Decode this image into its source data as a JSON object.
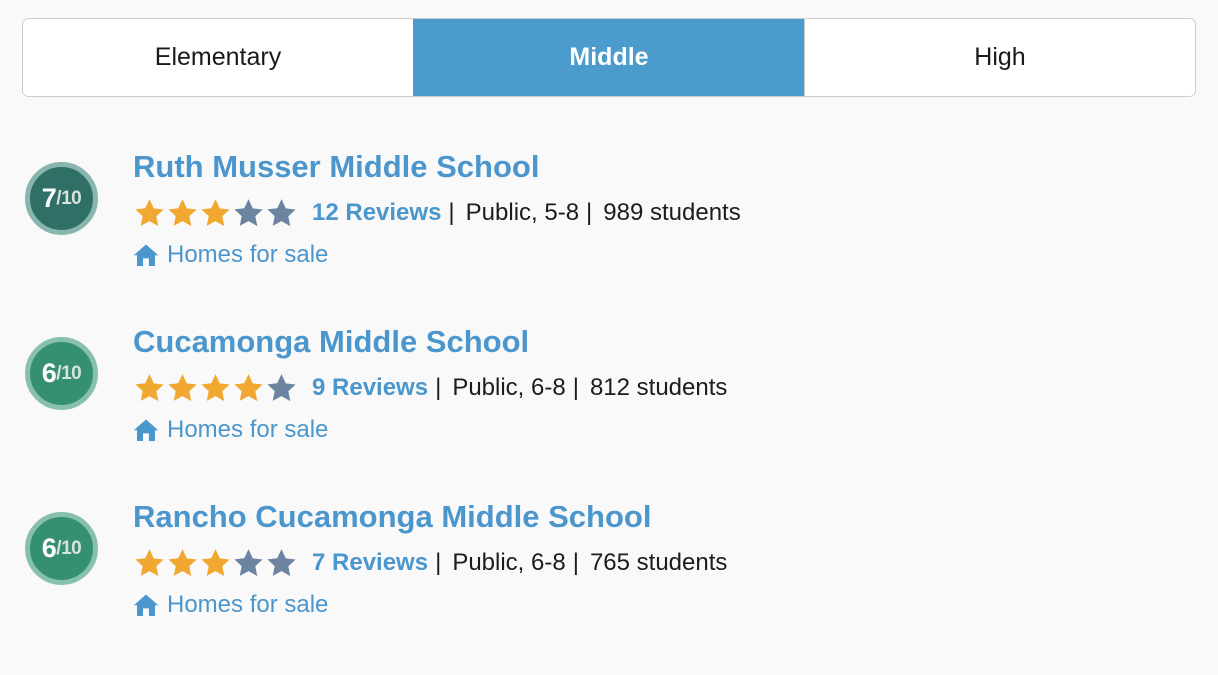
{
  "tabs": [
    {
      "label": "Elementary",
      "active": false
    },
    {
      "label": "Middle",
      "active": true
    },
    {
      "label": "High",
      "active": false
    }
  ],
  "colors": {
    "accent_blue": "#4b96cc",
    "tab_active_bg": "#4b9bcc",
    "star_filled": "#f0a830",
    "star_empty": "#6c84a0",
    "badge_7_fill": "#2f6f65",
    "badge_7_ring": "#88b5ad",
    "badge_6_fill": "#358f72",
    "badge_6_ring": "#88c0ae",
    "page_bg": "#f9f9f9",
    "text_dark": "#1c1c1c",
    "border": "#cccccc"
  },
  "schools": [
    {
      "rating_score": "7",
      "rating_denominator": "/10",
      "badge_fill": "#2f6f65",
      "badge_ring": "#88b5ad",
      "name": "Ruth Musser Middle School",
      "stars_filled": 3,
      "stars_total": 5,
      "reviews_label": "12 Reviews",
      "separator": "|",
      "type_grades": "Public, 5-8",
      "students": "989 students",
      "homes_label": "Homes for sale",
      "homes_icon": "home-icon"
    },
    {
      "rating_score": "6",
      "rating_denominator": "/10",
      "badge_fill": "#358f72",
      "badge_ring": "#88c0ae",
      "name": "Cucamonga Middle School",
      "stars_filled": 4,
      "stars_total": 5,
      "reviews_label": "9 Reviews",
      "separator": "|",
      "type_grades": "Public, 6-8",
      "students": "812 students",
      "homes_label": "Homes for sale",
      "homes_icon": "home-icon"
    },
    {
      "rating_score": "6",
      "rating_denominator": "/10",
      "badge_fill": "#358f72",
      "badge_ring": "#88c0ae",
      "name": "Rancho Cucamonga Middle School",
      "stars_filled": 3,
      "stars_total": 5,
      "reviews_label": "7 Reviews",
      "separator": "|",
      "type_grades": "Public, 6-8",
      "students": "765 students",
      "homes_label": "Homes for sale",
      "homes_icon": "home-icon"
    }
  ]
}
